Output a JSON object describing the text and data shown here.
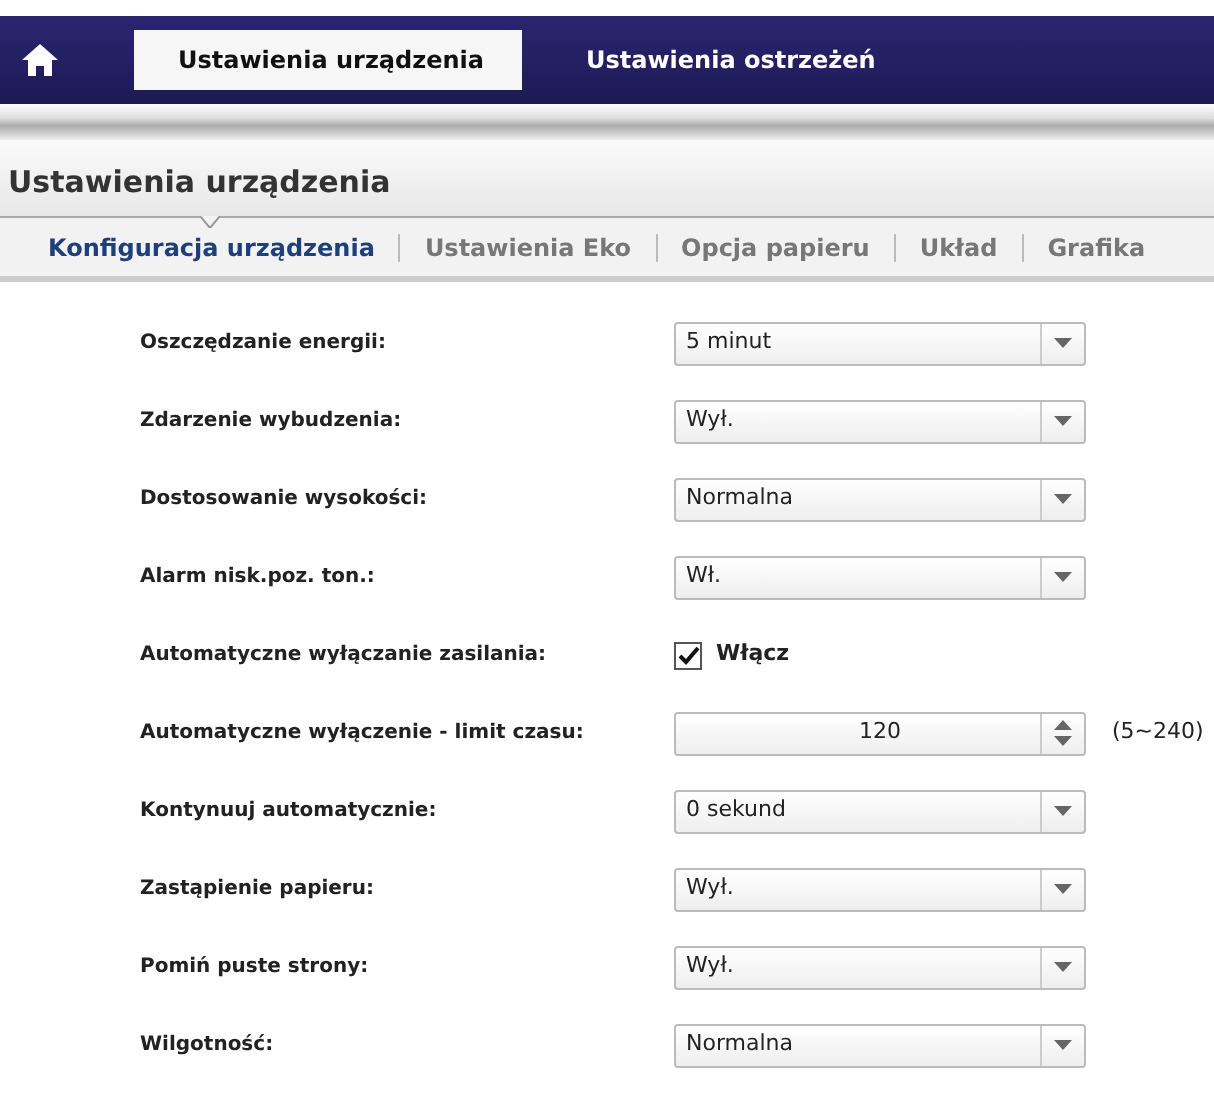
{
  "top_tabs": [
    {
      "label": "Ustawienia urządzenia",
      "selected": true
    },
    {
      "label": "Ustawienia ostrzeżeń",
      "selected": false
    }
  ],
  "section_title": "Ustawienia urządzenia",
  "sub_tabs": [
    {
      "label": "Konfiguracja urządzenia",
      "selected": true
    },
    {
      "label": "Ustawienia Eko",
      "selected": false
    },
    {
      "label": "Opcja papieru",
      "selected": false
    },
    {
      "label": "Układ",
      "selected": false
    },
    {
      "label": "Grafika",
      "selected": false
    }
  ],
  "settings": [
    {
      "kind": "select",
      "label": "Oszczędzanie energii:",
      "value": "5 minut"
    },
    {
      "kind": "select",
      "label": "Zdarzenie wybudzenia:",
      "value": "Wył."
    },
    {
      "kind": "select",
      "label": "Dostosowanie wysokości:",
      "value": "Normalna"
    },
    {
      "kind": "select",
      "label": "Alarm nisk.poz. ton.:",
      "value": "Wł."
    },
    {
      "kind": "checkbox",
      "label": "Automatyczne wyłączanie zasilania:",
      "option": "Włącz",
      "checked": true
    },
    {
      "kind": "spinner",
      "label": "Automatyczne wyłączenie - limit czasu:",
      "value": "120",
      "range": "(5~240)"
    },
    {
      "kind": "select",
      "label": "Kontynuuj automatycznie:",
      "value": "0 sekund"
    },
    {
      "kind": "select",
      "label": "Zastąpienie papieru:",
      "value": "Wył."
    },
    {
      "kind": "select",
      "label": "Pomiń puste strony:",
      "value": "Wył."
    },
    {
      "kind": "select",
      "label": "Wilgotność:",
      "value": "Normalna"
    }
  ]
}
